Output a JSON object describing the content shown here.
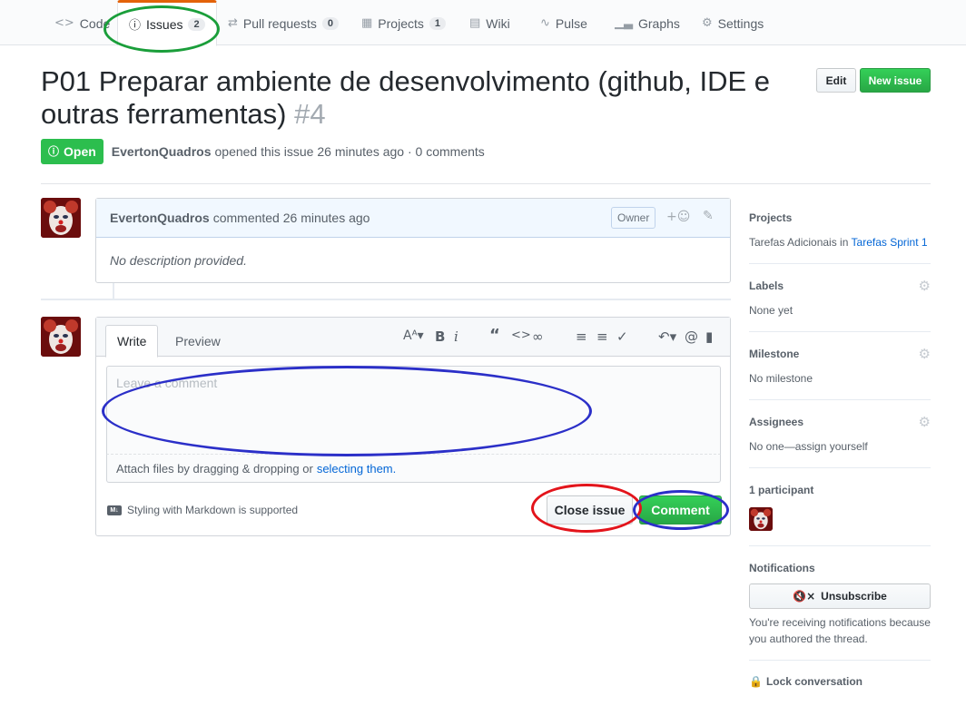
{
  "tabs": [
    {
      "icon": "code-icon",
      "label": "Code",
      "count": ""
    },
    {
      "icon": "issue-icon",
      "label": "Issues",
      "count": "2"
    },
    {
      "icon": "pull-request-icon",
      "label": "Pull requests",
      "count": "0"
    },
    {
      "icon": "project-icon",
      "label": "Projects",
      "count": "1"
    },
    {
      "icon": "book-icon",
      "label": "Wiki",
      "count": ""
    },
    {
      "icon": "pulse-icon",
      "label": "Pulse",
      "count": ""
    },
    {
      "icon": "graph-icon",
      "label": "Graphs",
      "count": ""
    },
    {
      "icon": "gear-icon",
      "label": "Settings",
      "count": ""
    }
  ],
  "issue": {
    "title": "P01 Preparar ambiente de desenvolvimento (github, IDE e outras ferramentas)",
    "number": "#4",
    "edit_label": "Edit",
    "new_issue_label": "New issue",
    "state": "Open",
    "author": "EvertonQuadros",
    "meta": "opened this issue 26 minutes ago · 0 comments"
  },
  "comment": {
    "author": "EvertonQuadros",
    "action": "commented 26 minutes ago",
    "owner_badge": "Owner",
    "body": "No description provided."
  },
  "composer": {
    "write_tab": "Write",
    "preview_tab": "Preview",
    "placeholder": "Leave a comment",
    "attach_text": "Attach files by dragging & dropping or",
    "attach_link": "selecting them.",
    "markdown_note": "Styling with Markdown is supported",
    "close_label": "Close issue",
    "comment_label": "Comment"
  },
  "sidebar": {
    "projects_heading": "Projects",
    "projects_prefix": "Tarefas Adicionais in",
    "projects_link": "Tarefas Sprint 1",
    "labels_heading": "Labels",
    "labels_value": "None yet",
    "milestone_heading": "Milestone",
    "milestone_value": "No milestone",
    "assignees_heading": "Assignees",
    "assignees_value": "No one—assign yourself",
    "participants_heading": "1 participant",
    "notifications_heading": "Notifications",
    "unsubscribe_label": "Unsubscribe",
    "notifications_text": "You're receiving notifications because you authored the thread.",
    "lock_label": "Lock conversation"
  },
  "colors": {
    "accent_green": "#2cbe4e",
    "link_blue": "#0366d6",
    "annotation_green": "#1a9e3a",
    "annotation_blue": "#2b2fc8",
    "annotation_red": "#e3141b"
  }
}
